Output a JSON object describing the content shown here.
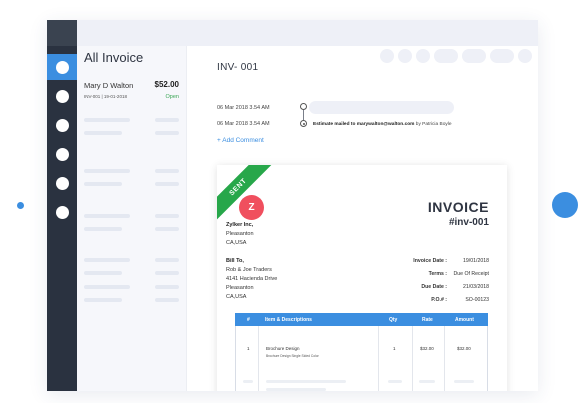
{
  "list": {
    "title": "All Invoice",
    "item": {
      "name": "Mary D Walton",
      "amount": "$52.00",
      "sub": "INV-001 | 19-01-2018",
      "status": "Open"
    }
  },
  "main": {
    "invoice_id": "INV- 001",
    "timeline": [
      {
        "date": "06 Mar 2018 3.54 AM",
        "text": ""
      },
      {
        "date": "06 Mar 2018 3.54 AM",
        "text_bold": "Estimate mailed to marywalton@walton.com",
        "text_rest": " by Patricia Boyle"
      }
    ],
    "add_comment": "+ Add Comment"
  },
  "invoice": {
    "ribbon": "SENT",
    "logo_letter": "Z",
    "company": [
      "Zylker Inc,",
      "Pleasanton",
      "CA,USA"
    ],
    "title": "INVOICE",
    "number": "#inv-001",
    "bill_to": [
      "Bill To,",
      "Rob & Joe Traders",
      "4141 Hacienda Drive",
      "Pleasanton",
      "CA,USA"
    ],
    "meta": [
      {
        "label": "Invoice Date :",
        "value": "19/01/2018"
      },
      {
        "label": "Terms :",
        "value": "Due Of Receipt"
      },
      {
        "label": "Due Date :",
        "value": "21/03/2018"
      },
      {
        "label": "P.O.# :",
        "value": "SO-00123"
      }
    ],
    "table": {
      "headers": [
        "#",
        "Item & Descriptions",
        "Qty",
        "Rate",
        "Amount"
      ],
      "rows": [
        {
          "num": "1",
          "item": "Brochure Design",
          "desc": "Brochure Design Single Sided Color",
          "qty": "1",
          "rate": "$32.00",
          "amount": "$32.00"
        }
      ]
    }
  },
  "colors": {
    "accent": "#3b8ee0",
    "sidebar": "#2a3240",
    "sent": "#27a74a",
    "logo": "#f04f5e",
    "open": "#3aa655"
  }
}
